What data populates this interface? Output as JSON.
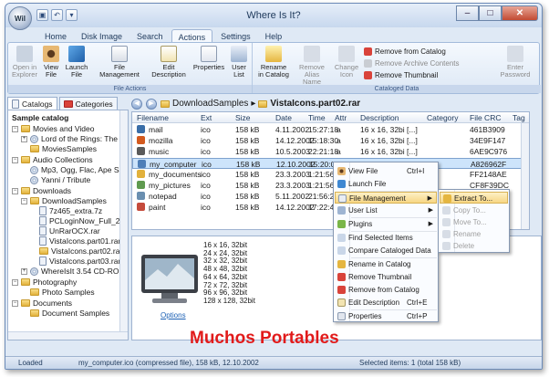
{
  "app": {
    "title": "Where Is It?"
  },
  "ribbon_tabs": [
    "Home",
    "Disk Image",
    "Search",
    "Actions",
    "Settings",
    "Help"
  ],
  "ribbon": {
    "file_actions": {
      "label": "File Actions",
      "open_in_explorer": "Open in Explorer",
      "view_file": "View File",
      "launch_file": "Launch File",
      "file_management": "File Management",
      "edit_description": "Edit Description",
      "properties": "Properties",
      "user_list": "User List"
    },
    "cataloged_data": {
      "label": "Cataloged Data",
      "rename_in_catalog": "Rename in Catalog",
      "remove_alias_name": "Remove Alias Name",
      "change_icon": "Change Icon",
      "remove_from_catalog": "Remove from Catalog",
      "remove_archive_contents": "Remove Archive Contents",
      "remove_thumbnail": "Remove Thumbnail",
      "enter_password": "Enter Password"
    }
  },
  "left_tabs": {
    "catalogs": "Catalogs",
    "categories": "Categories"
  },
  "tree": {
    "root": "Sample catalog",
    "items": [
      "Movies and Video",
      "Lord of the Rings: The Fe",
      "MoviesSamples",
      "Audio Collections",
      "Mp3, Ogg, Flac, Ape Sar",
      "Yanni / Tribute",
      "Downloads",
      "DownloadSamples",
      "7z465_extra.7z",
      "PCLoginNow_Full_2.0",
      "UnRarOCX.rar",
      "VistaIcons.part01.rar",
      "VistaIcons.part02.rar",
      "VistaIcons.part03.rar",
      "WhereIsIt 3.54 CD-ROM",
      "Photography",
      "Photo Samples",
      "Documents",
      "Document Samples"
    ]
  },
  "breadcrumb": [
    "DownloadSamples",
    "VistaIcons.part02.rar"
  ],
  "columns": [
    "Filename",
    "Ext",
    "Size",
    "Date",
    "Time",
    "Attr",
    "Description",
    "Category",
    "File CRC",
    "Tag"
  ],
  "rows": [
    {
      "name": "mail",
      "ext": "ico",
      "size": "158 kB",
      "date": "4.11.2002",
      "time": "15:27:18",
      "attr": "a",
      "desc": "16 x 16, 32bi [...]",
      "crc": "461B3909"
    },
    {
      "name": "mozilla",
      "ext": "ico",
      "size": "158 kB",
      "date": "14.12.2002",
      "time": "15:18:30",
      "attr": "a",
      "desc": "16 x 16, 32bi [...]",
      "crc": "34E9F147"
    },
    {
      "name": "music",
      "ext": "ico",
      "size": "158 kB",
      "date": "10.5.2003",
      "time": "22:21:18",
      "attr": "a",
      "desc": "16 x 16, 32bi [...]",
      "crc": "6AE9C976"
    },
    {
      "name": "my_computer",
      "ext": "ico",
      "size": "158 kB",
      "date": "12.10.2002",
      "time": "15:20:08",
      "attr": "",
      "desc": "",
      "crc": "A826962F"
    },
    {
      "name": "my_documents",
      "ext": "ico",
      "size": "158 kB",
      "date": "23.3.2003",
      "time": "1:21:56",
      "attr": "",
      "desc": "",
      "crc": "FF2148AE"
    },
    {
      "name": "my_pictures",
      "ext": "ico",
      "size": "158 kB",
      "date": "23.3.2003",
      "time": "1:21:56",
      "attr": "",
      "desc": "",
      "crc": "CF8F39DC"
    },
    {
      "name": "notepad",
      "ext": "ico",
      "size": "158 kB",
      "date": "5.11.2002",
      "time": "21:56:21",
      "attr": "",
      "desc": "",
      "crc": ""
    },
    {
      "name": "paint",
      "ext": "ico",
      "size": "158 kB",
      "date": "14.12.2002",
      "time": "17:22:40",
      "attr": "",
      "desc": "",
      "crc": ""
    }
  ],
  "preview": {
    "info": [
      "16 x 16, 32bit",
      "24 x 24, 32bit",
      "32 x 32, 32bit",
      "48 x 48, 32bit",
      "64 x 64, 32bit",
      "72 x 72, 32bit",
      "96 x 96, 32bit",
      "128 x 128, 32bit"
    ],
    "options_link": "Options"
  },
  "context_menu": {
    "view_file": "View File",
    "view_file_shortcut": "Ctrl+I",
    "launch_file": "Launch File",
    "file_management": "File Management",
    "user_list": "User List",
    "plugins": "Plugins",
    "find_selected_items": "Find Selected Items",
    "compare_cataloged_data": "Compare Cataloged Data",
    "rename_in_catalog": "Rename in Catalog",
    "remove_thumbnail": "Remove Thumbnail",
    "remove_from_catalog": "Remove from Catalog",
    "edit_description": "Edit Description",
    "edit_description_shortcut": "Ctrl+E",
    "properties": "Properties",
    "properties_shortcut": "Ctrl+P"
  },
  "submenu": {
    "extract_to": "Extract To...",
    "copy_to": "Copy To...",
    "move_to": "Move To...",
    "rename": "Rename",
    "delete": "Delete"
  },
  "watermark": "Muchos Portables",
  "status": {
    "left": "Loaded",
    "middle": "my_computer.ico (compressed file), 158 kB, 12.10.2002",
    "right": "Selected items: 1 (total 158 kB)"
  },
  "colors": {
    "accent": "#cde4fb",
    "menu_highlight": "#f7d684",
    "watermark": "#e11a1a"
  }
}
